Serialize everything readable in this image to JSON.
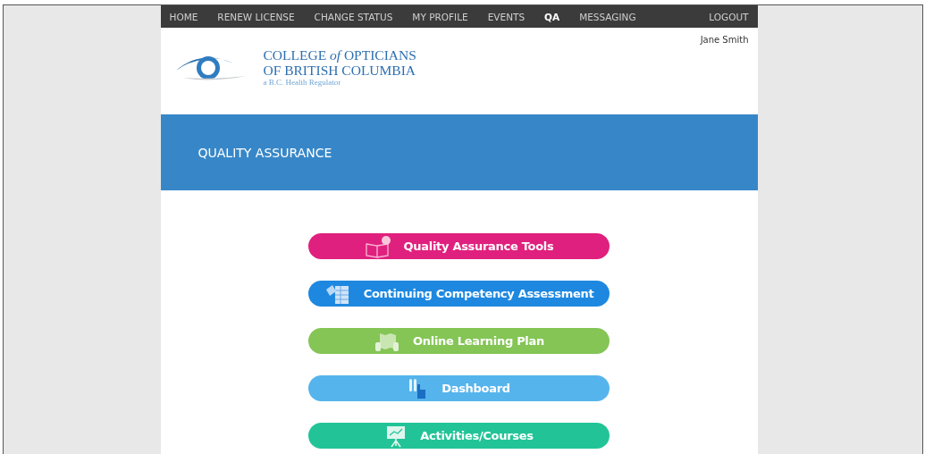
{
  "nav": {
    "items": [
      {
        "label": "HOME",
        "selected": false
      },
      {
        "label": "RENEW LICENSE",
        "selected": false
      },
      {
        "label": "CHANGE STATUS",
        "selected": false
      },
      {
        "label": "MY PROFILE",
        "selected": false
      },
      {
        "label": "EVENTS",
        "selected": false
      },
      {
        "label": "QA",
        "selected": true
      },
      {
        "label": "MESSAGING",
        "selected": false
      }
    ],
    "logout": "LOGOUT"
  },
  "header": {
    "user": "Jane Smith",
    "logo_lines": [
      "COLLEGE *of* OPTICIANS",
      "OF BRITISH COLUMBIA"
    ],
    "tagline": "a B.C. Health Regulator"
  },
  "banner": {
    "title": "QUALITY ASSURANCE"
  },
  "buttons": [
    {
      "label": "Quality Assurance Tools",
      "kind": "book",
      "color": "#e0207e"
    },
    {
      "label": "Continuing Competency Assessment",
      "kind": "table",
      "color": "#1e88e0"
    },
    {
      "label": "Online Learning Plan",
      "kind": "map",
      "color": "#84c556"
    },
    {
      "label": "Dashboard",
      "kind": "hand",
      "color": "#56b4ec"
    },
    {
      "label": "Activities/Courses",
      "kind": "easel",
      "color": "#22c497"
    }
  ]
}
